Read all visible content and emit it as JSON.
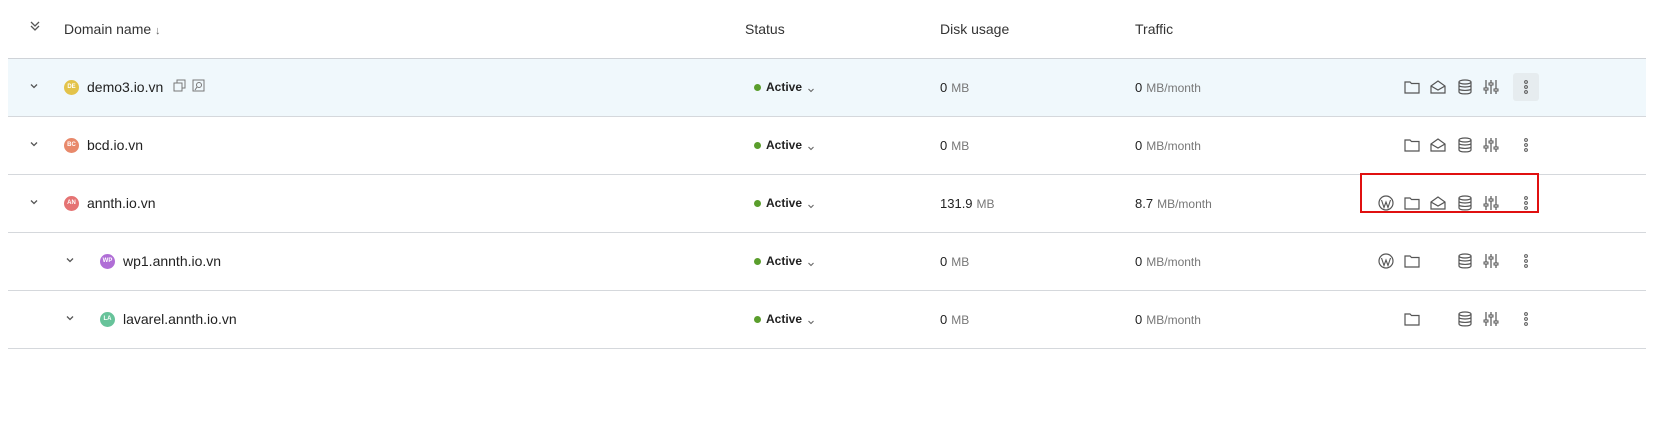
{
  "header": {
    "collapse_all_icon": "double-chevron-down-icon",
    "domain_label": "Domain name",
    "sort_icon": "sort-down-arrow-icon",
    "status_label": "Status",
    "disk_label": "Disk usage",
    "traffic_label": "Traffic"
  },
  "rows": [
    {
      "avatar": "DE",
      "avatar_color": "#e3c34a",
      "name": "demo3.io.vn",
      "status": "Active",
      "disk_value": "0",
      "disk_unit": "MB",
      "traffic_value": "0",
      "traffic_unit": "MB/month"
    },
    {
      "avatar": "BC",
      "avatar_color": "#e8896b",
      "name": "bcd.io.vn",
      "status": "Active",
      "disk_value": "0",
      "disk_unit": "MB",
      "traffic_value": "0",
      "traffic_unit": "MB/month"
    },
    {
      "avatar": "AN",
      "avatar_color": "#e57373",
      "name": "annth.io.vn",
      "status": "Active",
      "disk_value": "131.9",
      "disk_unit": "MB",
      "traffic_value": "8.7",
      "traffic_unit": "MB/month"
    },
    {
      "avatar": "WP",
      "avatar_color": "#b06ed6",
      "name": "wp1.annth.io.vn",
      "status": "Active",
      "disk_value": "0",
      "disk_unit": "MB",
      "traffic_value": "0",
      "traffic_unit": "MB/month"
    },
    {
      "avatar": "LA",
      "avatar_color": "#67c39a",
      "name": "lavarel.annth.io.vn",
      "status": "Active",
      "disk_value": "0",
      "disk_unit": "MB",
      "traffic_value": "0",
      "traffic_unit": "MB/month"
    }
  ],
  "colors": {
    "status_active": "#5a9e2c",
    "highlight": "#e01010",
    "selected_row": "#f0f8fc"
  }
}
